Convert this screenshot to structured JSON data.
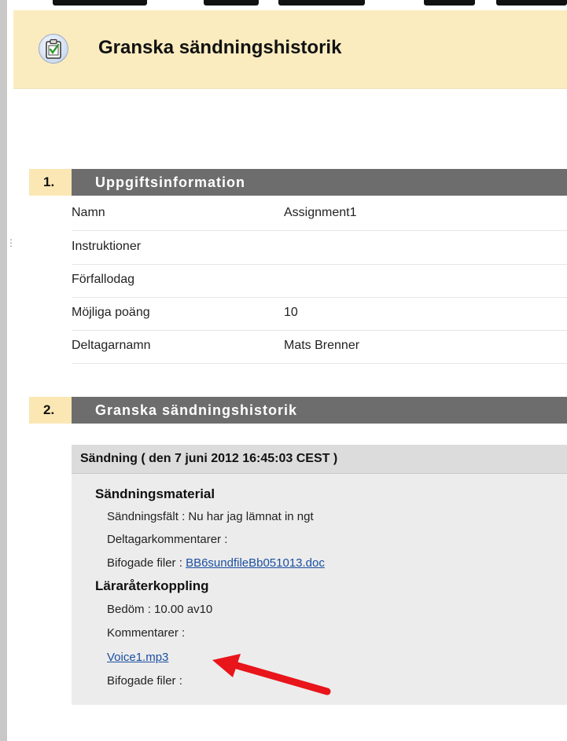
{
  "header": {
    "title": "Granska sändningshistorik",
    "icon": "clipboard-check-icon"
  },
  "section1": {
    "number": "1.",
    "title": "Uppgiftsinformation",
    "rows": [
      {
        "label": "Namn",
        "value": "Assignment1"
      },
      {
        "label": "Instruktioner",
        "value": ""
      },
      {
        "label": "Förfallodag",
        "value": ""
      },
      {
        "label": "Möjliga poäng",
        "value": "10"
      },
      {
        "label": "Deltagarnamn",
        "value": "Mats Brenner"
      }
    ]
  },
  "section2": {
    "number": "2.",
    "title": "Granska sändningshistorik",
    "submission": {
      "heading": "Sändning ( den 7 juni 2012 16:45:03 CEST )",
      "material_heading": "Sändningsmaterial",
      "submission_field": "Sändningsfält : Nu har jag lämnat in ngt",
      "participant_comments": "Deltagarkommentarer :",
      "attached_files_label": "Bifogade filer :",
      "attached_file_link": "BB6sundfileBb051013.doc",
      "feedback_heading": "Läraråterkoppling",
      "grade": "Bedöm : 10.00 av10",
      "comments_label": "Kommentarer :",
      "voice_link": "Voice1.mp3",
      "feedback_files_label": "Bifogade filer :"
    }
  },
  "colors": {
    "header_bg": "#fbecc0",
    "section_number_bg": "#fbe7b4",
    "section_title_bg": "#6d6d6d",
    "link": "#1a4fa0",
    "arrow": "#e8151b"
  }
}
